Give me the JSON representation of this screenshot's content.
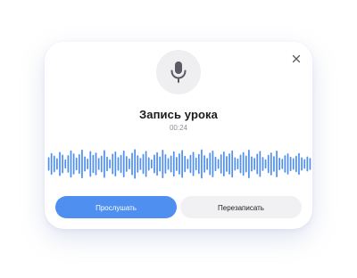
{
  "dialog": {
    "title": "Запись урока",
    "duration": "00:24",
    "close_icon": "close-icon",
    "mic_icon": "microphone-icon"
  },
  "waveform": {
    "color": "#4e8ff0",
    "levels": [
      0.45,
      0.72,
      0.55,
      0.38,
      0.8,
      0.62,
      0.3,
      0.58,
      0.9,
      0.7,
      0.42,
      0.65,
      0.95,
      0.5,
      0.35,
      0.85,
      0.6,
      0.75,
      0.4,
      0.55,
      0.92,
      0.48,
      0.3,
      0.68,
      0.82,
      0.45,
      0.6,
      0.88,
      0.52,
      0.36,
      0.74,
      0.98,
      0.58,
      0.4,
      0.66,
      0.86,
      0.44,
      0.3,
      0.62,
      0.78,
      0.5,
      0.94,
      0.64,
      0.38,
      0.56,
      0.84,
      0.46,
      0.7,
      0.92,
      0.54,
      0.34,
      0.6,
      0.8,
      0.42,
      0.66,
      0.96,
      0.58,
      0.4,
      0.74,
      0.88,
      0.48,
      0.32,
      0.64,
      0.82,
      0.52,
      0.7,
      0.9,
      0.44,
      0.36,
      0.62,
      0.78,
      0.56,
      0.94,
      0.5,
      0.4,
      0.68,
      0.86,
      0.46,
      0.3,
      0.6,
      0.76,
      0.52,
      0.88,
      0.42,
      0.34,
      0.58,
      0.7,
      0.48,
      0.38,
      0.54,
      0.72,
      0.44,
      0.32,
      0.5,
      0.4
    ]
  },
  "actions": {
    "listen_label": "Прослушать",
    "rerecord_label": "Перезаписать"
  },
  "colors": {
    "accent": "#4e8ff0",
    "secondary_bg": "#f1f1f3"
  }
}
